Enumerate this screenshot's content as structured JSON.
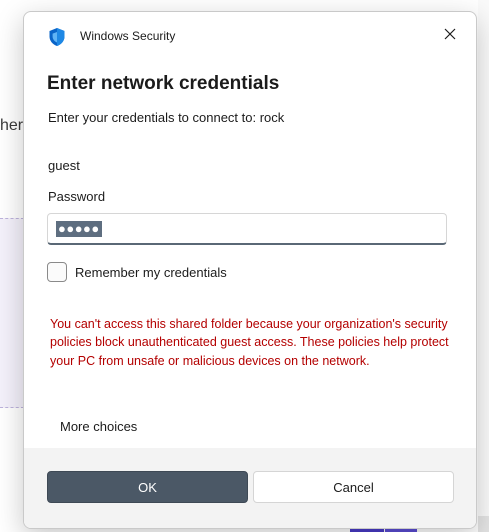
{
  "background": {
    "fragment_text": "her"
  },
  "dialog": {
    "app_title": "Windows Security",
    "app_icon": "shield-icon",
    "close_icon": "close-icon",
    "heading": "Enter network credentials",
    "subtext": "Enter your credentials to connect to: rock",
    "username": "guest",
    "password_label": "Password",
    "password_value": "●●●●●",
    "remember_label": "Remember my credentials",
    "remember_checked": false,
    "error_message": "You can't access this shared folder because your organization's security policies block unauthenticated guest access. These policies help protect your PC from unsafe or malicious devices on the network.",
    "more_choices": "More choices",
    "ok_label": "OK",
    "cancel_label": "Cancel"
  },
  "colors": {
    "accent": "#4b5866",
    "error": "#b40000",
    "shield": "#0a64c8"
  }
}
